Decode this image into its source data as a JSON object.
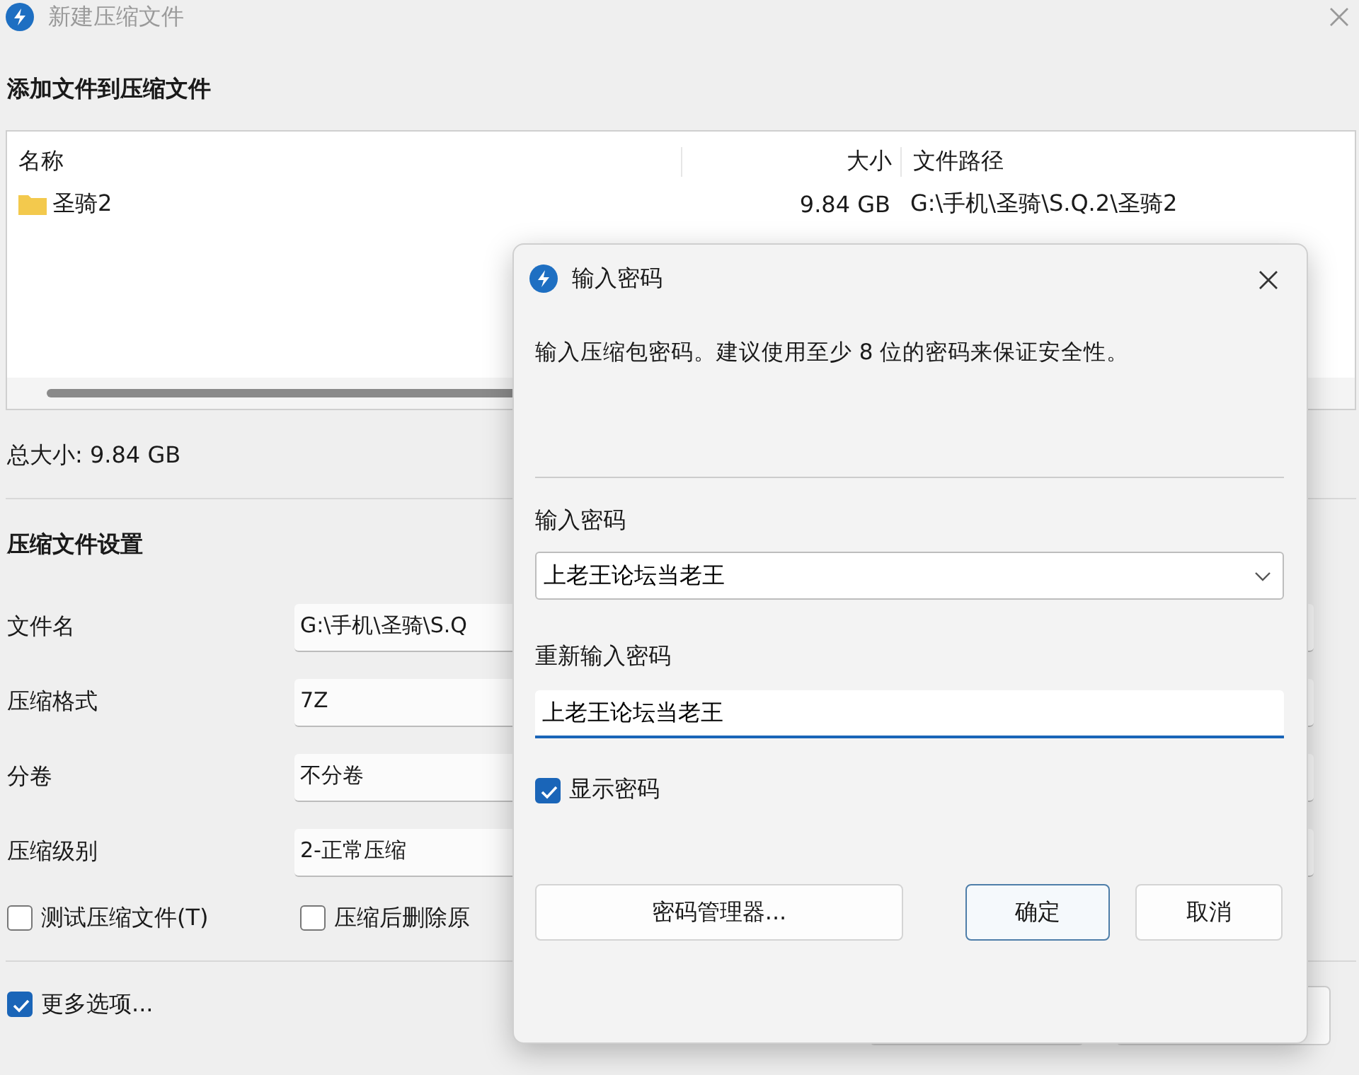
{
  "window": {
    "title": "新建压缩文件",
    "active": false
  },
  "add_section": {
    "heading": "添加文件到压缩文件",
    "columns": [
      "名称",
      "大小",
      "文件路径"
    ],
    "rows": [
      {
        "name": "圣骑2",
        "size": "9.84 GB",
        "path": "G:\\手机\\圣骑\\S.Q.2\\圣骑2"
      }
    ],
    "total_size": "总大小: 9.84 GB"
  },
  "settings": {
    "heading": "压缩文件设置",
    "fields": [
      {
        "label": "文件名",
        "value": "G:\\手机\\圣骑\\S.Q"
      },
      {
        "label": "压缩格式",
        "value": "7Z"
      },
      {
        "label": "分卷",
        "value": "不分卷"
      },
      {
        "label": "压缩级别",
        "value": "2-正常压缩"
      }
    ],
    "checkboxes": [
      {
        "label": "测试压缩文件(T)",
        "checked": false
      },
      {
        "label": "压缩后删除原",
        "checked": false
      }
    ],
    "more_options": {
      "label": "更多选项...",
      "checked": true
    }
  },
  "dialog": {
    "title": "输入密码",
    "message": "输入压缩包密码。建议使用至少 8 位的密码来保证安全性。",
    "password_label": "输入密码",
    "password": "上老王论坛当老王",
    "confirm_label": "重新输入密码",
    "confirm": "上老王论坛当老王",
    "show_password": {
      "label": "显示密码",
      "checked": true
    },
    "buttons": [
      {
        "label": "密码管理器...",
        "default": false
      },
      {
        "label": "确定",
        "default": true
      },
      {
        "label": "取消",
        "default": false
      }
    ]
  }
}
